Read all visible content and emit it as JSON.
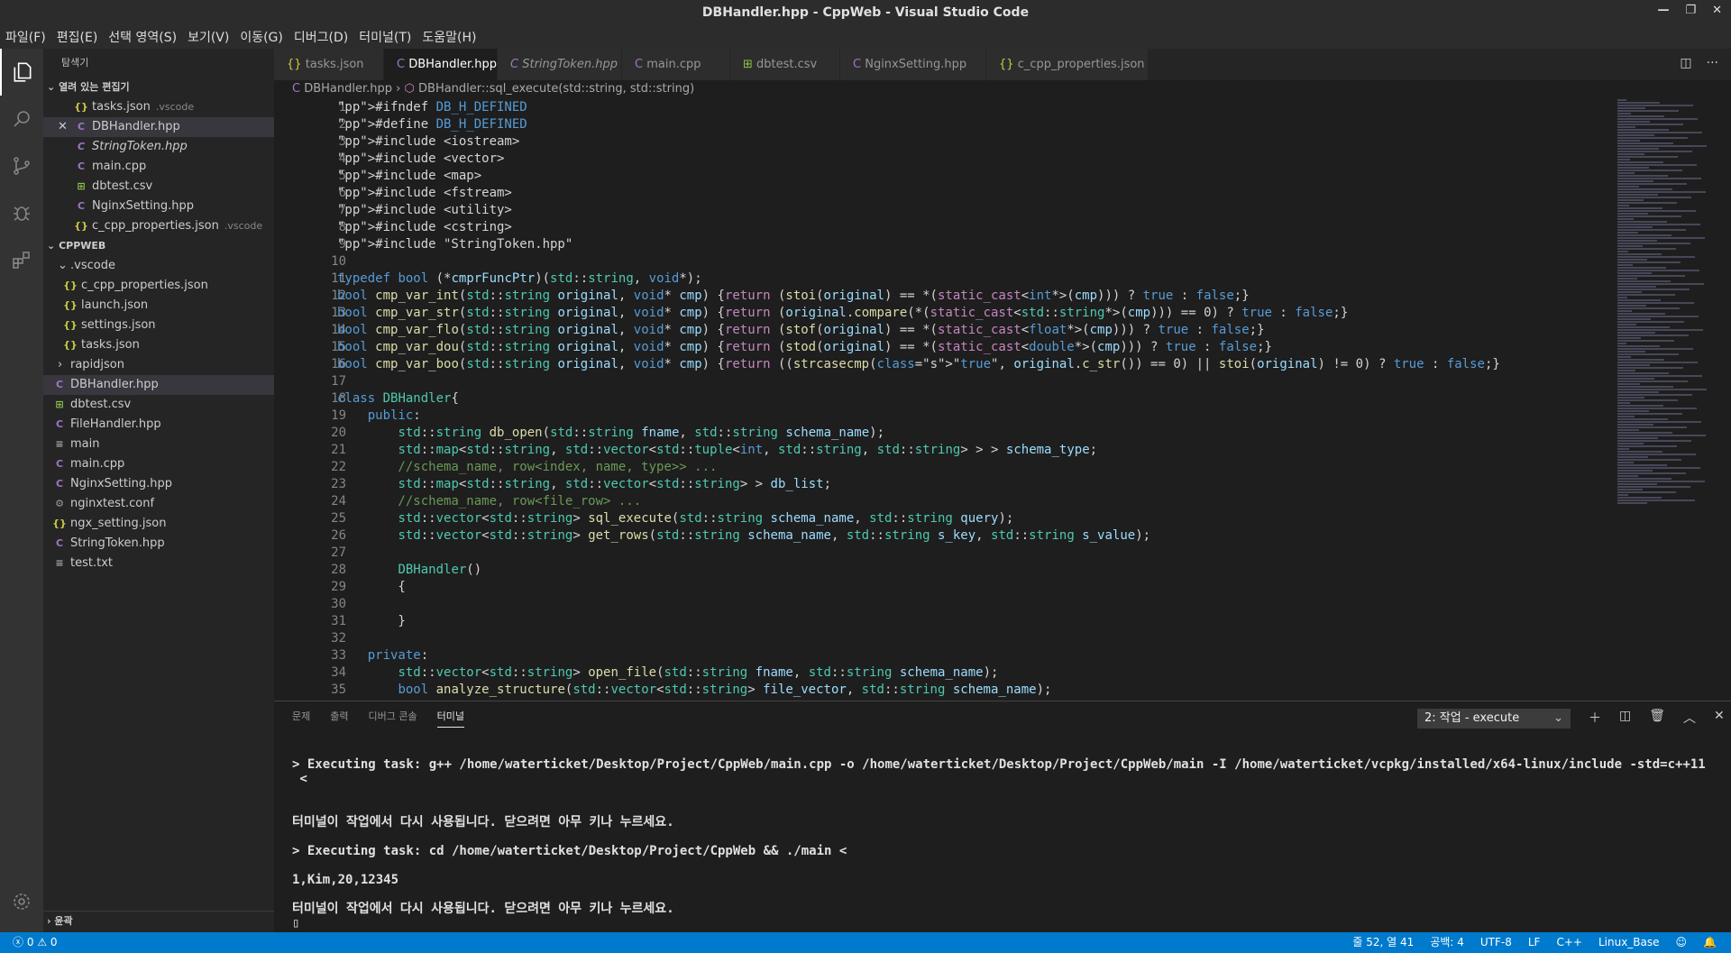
{
  "window": {
    "title": "DBHandler.hpp - CppWeb - Visual Studio Code"
  },
  "menu": [
    "파일(F)",
    "편집(E)",
    "선택 영역(S)",
    "보기(V)",
    "이동(G)",
    "디버그(D)",
    "터미널(T)",
    "도움말(H)"
  ],
  "sidebar": {
    "title": "탐색기",
    "open_editors_header": "열려 있는 편집기",
    "open_editors": [
      {
        "icon": "{}",
        "name": "tasks.json",
        "hint": ".vscode"
      },
      {
        "icon": "C",
        "name": "DBHandler.hpp",
        "hint": ""
      },
      {
        "icon": "C",
        "name": "StringToken.hpp",
        "hint": ""
      },
      {
        "icon": "C",
        "name": "main.cpp",
        "hint": ""
      },
      {
        "icon": "⊞",
        "name": "dbtest.csv",
        "hint": ""
      },
      {
        "icon": "C",
        "name": "NginxSetting.hpp",
        "hint": ""
      },
      {
        "icon": "{}",
        "name": "c_cpp_properties.json",
        "hint": ".vscode"
      }
    ],
    "project_header": "CPPWEB",
    "vscode_folder": ".vscode",
    "vscode_files": [
      "c_cpp_properties.json",
      "launch.json",
      "settings.json",
      "tasks.json"
    ],
    "rapidjson_folder": "rapidjson",
    "files": [
      "DBHandler.hpp",
      "dbtest.csv",
      "FileHandler.hpp",
      "main",
      "main.cpp",
      "NginxSetting.hpp",
      "nginxtest.conf",
      "ngx_setting.json",
      "StringToken.hpp",
      "test.txt"
    ],
    "outline_header": "윤곽"
  },
  "tabs": [
    "tasks.json",
    "DBHandler.hpp",
    "StringToken.hpp",
    "main.cpp",
    "dbtest.csv",
    "NginxSetting.hpp",
    "c_cpp_properties.json"
  ],
  "breadcrumb": {
    "file": "DBHandler.hpp",
    "symbol": "DBHandler::sql_execute(std::string, std::string)"
  },
  "code_lines": [
    "#ifndef DB_H_DEFINED",
    "#define DB_H_DEFINED",
    "#include <iostream>",
    "#include <vector>",
    "#include <map>",
    "#include <fstream>",
    "#include <utility>",
    "#include <cstring>",
    "#include \"StringToken.hpp\"",
    "",
    "typedef bool (*cmprFuncPtr)(std::string, void*);",
    "bool cmp_var_int(std::string original, void* cmp) {return (stoi(original) == *(static_cast<int*>(cmp))) ? true : false;}",
    "bool cmp_var_str(std::string original, void* cmp) {return (original.compare(*(static_cast<std::string*>(cmp))) == 0) ? true : false;}",
    "bool cmp_var_flo(std::string original, void* cmp) {return (stof(original) == *(static_cast<float*>(cmp))) ? true : false;}",
    "bool cmp_var_dou(std::string original, void* cmp) {return (stod(original) == *(static_cast<double*>(cmp))) ? true : false;}",
    "bool cmp_var_boo(std::string original, void* cmp) {return ((strcasecmp(\"true\", original.c_str()) == 0) || stoi(original) != 0) ? true : false;}",
    "",
    "class DBHandler{",
    "    public:",
    "        std::string db_open(std::string fname, std::string schema_name);",
    "        std::map<std::string, std::vector<std::tuple<int, std::string, std::string> > > schema_type;",
    "        //schema_name, row<index, name, type>> ...",
    "        std::map<std::string, std::vector<std::string> > db_list;",
    "        //schema_name, row<file_row> ...",
    "        std::vector<std::string> sql_execute(std::string schema_name, std::string query);",
    "        std::vector<std::string> get_rows(std::string schema_name, std::string s_key, std::string s_value);",
    "",
    "        DBHandler()",
    "        {",
    "",
    "        }",
    "",
    "    private:",
    "        std::vector<std::string> open_file(std::string fname, std::string schema_name);",
    "        bool analyze_structure(std::vector<std::string> file_vector, std::string schema_name);"
  ],
  "panel": {
    "tabs": [
      "문제",
      "출력",
      "디버그 콘솔",
      "터미널"
    ],
    "select": "2: 작업 - execute",
    "terminal_lines": [
      "> Executing task: g++ /home/waterticket/Desktop/Project/CppWeb/main.cpp -o /home/waterticket/Desktop/Project/CppWeb/main -I /home/waterticket/vcpkg/installed/x64-linux/include -std=c++11",
      " <",
      "",
      "",
      "터미널이 작업에서 다시 사용됩니다. 닫으려면 아무 키나 누르세요.",
      "",
      "> Executing task: cd /home/waterticket/Desktop/Project/CppWeb && ./main <",
      "",
      "1,Kim,20,12345",
      "",
      "터미널이 작업에서 다시 사용됩니다. 닫으려면 아무 키나 누르세요."
    ]
  },
  "status": {
    "errors": "0",
    "warnings": "0",
    "position": "줄 52, 열 41",
    "spaces": "공백: 4",
    "encoding": "UTF-8",
    "eol": "LF",
    "language": "C++",
    "config": "Linux_Base"
  }
}
